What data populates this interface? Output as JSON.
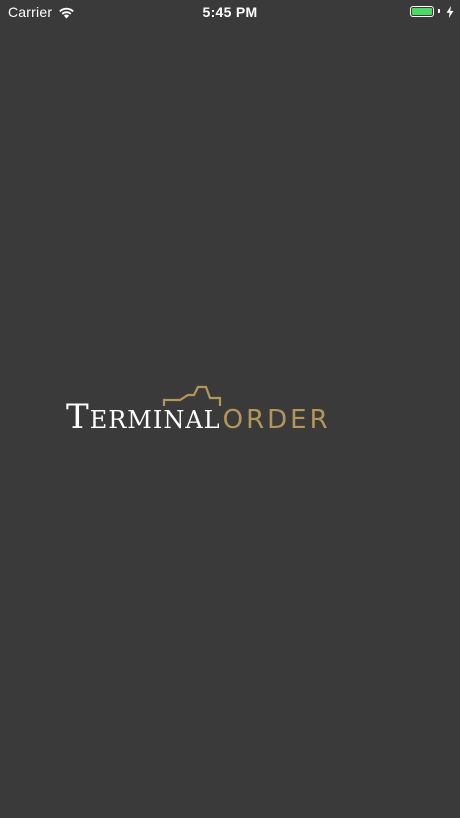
{
  "status_bar": {
    "carrier": "Carrier",
    "time": "5:45 PM",
    "battery_level": 1.0,
    "battery_color": "#4cd964",
    "icons": [
      "wifi-icon",
      "battery-icon",
      "charging-bolt-icon"
    ]
  },
  "splash": {
    "background_color": "#3a3a3a",
    "logo": {
      "word_1_first": "T",
      "word_1_rest": "ERMINAL",
      "word_2": "ORDER",
      "word_1_color": "#ffffff",
      "word_2_color": "#b4965a"
    }
  }
}
